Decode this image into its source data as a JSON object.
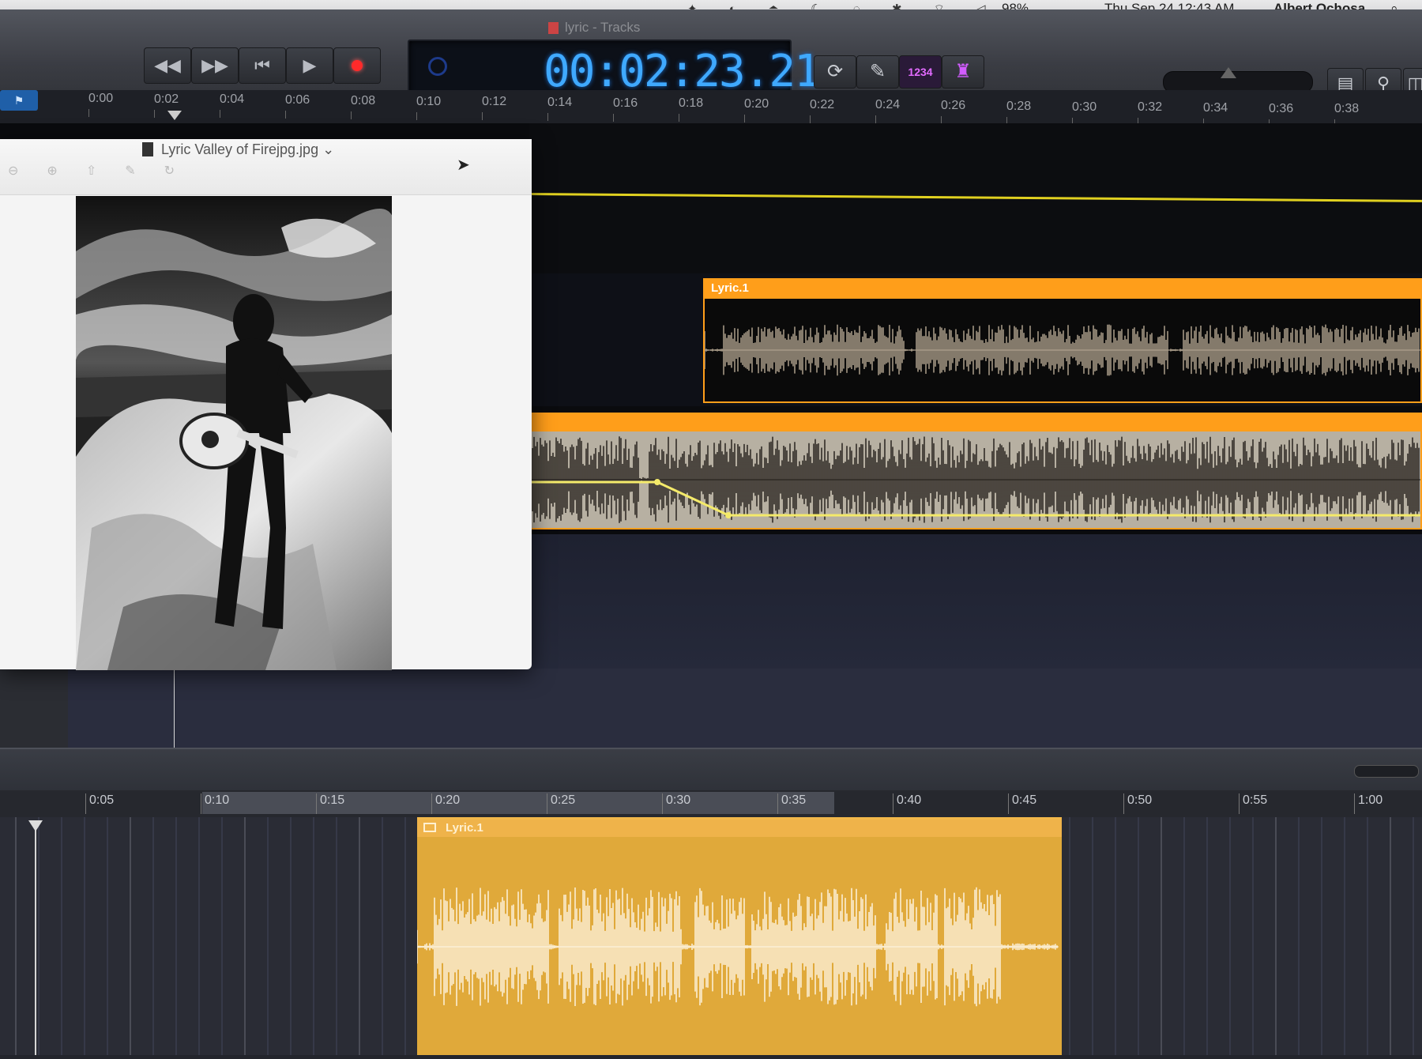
{
  "menubar": {
    "battery": "98%",
    "clock": "Thu Sep 24  12:43 AM",
    "user": "Albert Ochosa"
  },
  "window": {
    "title": "lyric - Tracks"
  },
  "transport": {
    "rewind_icon": "rewind-icon",
    "forward_icon": "fast-forward-icon",
    "start_icon": "go-to-beginning-icon",
    "play_icon": "play-icon",
    "record_icon": "record-icon",
    "record_color": "#ff2a2a"
  },
  "lcd": {
    "time": "00:02:23.21",
    "color": "#3fa9ff"
  },
  "tools": {
    "count_in_label": "1234"
  },
  "ruler": {
    "ticks": [
      "0:00",
      "0:02",
      "0:04",
      "0:06",
      "0:08",
      "0:10",
      "0:12",
      "0:14",
      "0:16",
      "0:18",
      "0:20",
      "0:22",
      "0:24",
      "0:26",
      "0:28",
      "0:30",
      "0:32",
      "0:34",
      "0:36",
      "0:38"
    ]
  },
  "regions": {
    "upper_label": "Lyric.1",
    "lower_label": "Lyric.1",
    "region_color": "#ff9e1a"
  },
  "preview": {
    "title": "Lyric Valley of Firejpg.jpg ⌄"
  },
  "lower_ruler": {
    "ticks": [
      "0:05",
      "0:10",
      "0:15",
      "0:20",
      "0:25",
      "0:30",
      "0:35",
      "0:40",
      "0:45",
      "0:50",
      "0:55",
      "1:00"
    ]
  }
}
